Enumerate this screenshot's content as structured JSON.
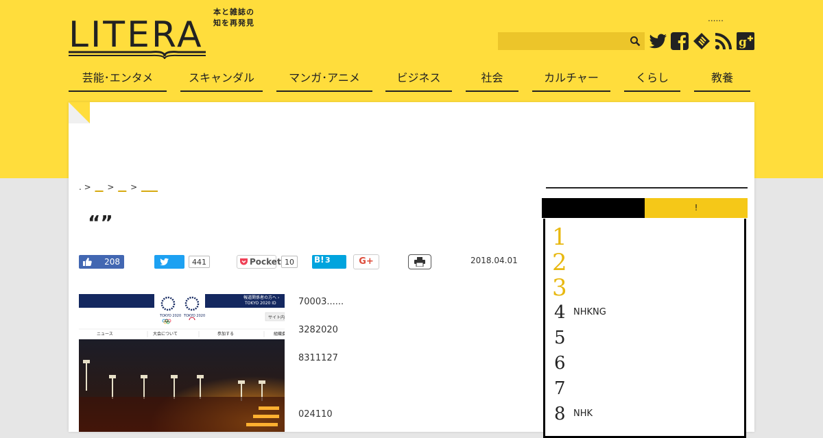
{
  "header": {
    "logo_text": "LITERA",
    "tagline_line1": "本と雑誌の",
    "tagline_line2": "知を再発見",
    "top_dots": "......",
    "search_placeholder": ""
  },
  "social_icons": [
    "twitter-icon",
    "facebook-icon",
    "feedly-icon",
    "rss-icon",
    "google-plus-icon"
  ],
  "nav": [
    {
      "label": "芸能･エンタメ"
    },
    {
      "label": "スキャンダル"
    },
    {
      "label": "マンガ･アニメ"
    },
    {
      "label": "ビジネス"
    },
    {
      "label": "社会"
    },
    {
      "label": "カルチャー"
    },
    {
      "label": "くらし"
    },
    {
      "label": "教養"
    }
  ],
  "breadcrumb": {
    "lead": ".",
    "sep": ">",
    "items": [
      "__",
      "__",
      "____"
    ]
  },
  "article": {
    "title": "“”",
    "date": "2018.04.01",
    "share": {
      "facebook_count": "208",
      "twitter_count": "441",
      "pocket_label": "Pocket",
      "pocket_count": "10",
      "hatena_label": "B!",
      "hatena_count": "3",
      "gplus_label": "G+"
    },
    "image": {
      "link1": "報道関係者の方へ ›",
      "link2": "TOKYO 2020 ID",
      "logo_caption": "TOKYO 2020",
      "menu": [
        "ニュース",
        "大会について",
        "参加する",
        "組織委"
      ],
      "site_label": "サイト内"
    },
    "body": [
      "70003......",
      "3282020",
      "8311127",
      "024110"
    ]
  },
  "sidebar": {
    "tab_left": "",
    "tab_right": "!",
    "ranks": [
      {
        "num": "1",
        "text": ""
      },
      {
        "num": "2",
        "text": ""
      },
      {
        "num": "3",
        "text": ""
      },
      {
        "num": "4",
        "text": "NHKNG"
      },
      {
        "num": "5",
        "text": ""
      },
      {
        "num": "6",
        "text": ""
      },
      {
        "num": "7",
        "text": ""
      },
      {
        "num": "8",
        "text": "NHK"
      }
    ]
  },
  "colors": {
    "brand_yellow": "#ffdd3c",
    "accent_gold": "#e8b810",
    "facebook": "#4267b2",
    "twitter": "#1da1f2",
    "hatena": "#00a4de"
  }
}
